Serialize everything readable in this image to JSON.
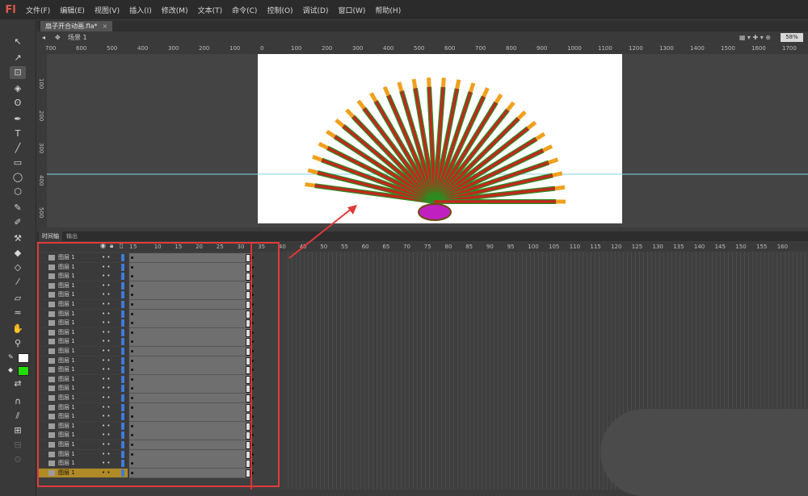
{
  "app": {
    "logo": "Fl"
  },
  "menu": [
    "文件(F)",
    "编辑(E)",
    "视图(V)",
    "插入(I)",
    "修改(M)",
    "文本(T)",
    "命令(C)",
    "控制(O)",
    "调试(D)",
    "窗口(W)",
    "帮助(H)"
  ],
  "document": {
    "tab": "扇子开合动画.fla*",
    "close": "×",
    "scene": "场景 1",
    "zoom": "58%"
  },
  "ruler_h": [
    "700",
    "600",
    "500",
    "400",
    "300",
    "200",
    "100",
    "0",
    "100",
    "200",
    "300",
    "400",
    "500",
    "600",
    "700",
    "800",
    "900",
    "1000",
    "1100",
    "1200",
    "1300",
    "1400",
    "1500",
    "1600",
    "1700"
  ],
  "ruler_v": [
    "100",
    "200",
    "300",
    "400",
    "500"
  ],
  "panels": {
    "timeline": "时间轴",
    "output": "输出"
  },
  "frame_numbers": [
    "1",
    "5",
    "10",
    "15",
    "20",
    "25",
    "30",
    "35",
    "40",
    "45",
    "50",
    "55",
    "60",
    "65",
    "70",
    "75",
    "80",
    "85",
    "90",
    "95",
    "100",
    "105",
    "110",
    "115",
    "120",
    "125",
    "130",
    "135",
    "140",
    "145",
    "150",
    "155",
    "160"
  ],
  "layers": [
    {
      "name": "图层 1"
    },
    {
      "name": "图层 1"
    },
    {
      "name": "图层 1"
    },
    {
      "name": "图层 1"
    },
    {
      "name": "图层 1"
    },
    {
      "name": "图层 1"
    },
    {
      "name": "图层 1"
    },
    {
      "name": "图层 1"
    },
    {
      "name": "图层 1"
    },
    {
      "name": "图层 1"
    },
    {
      "name": "图层 1"
    },
    {
      "name": "图层 1"
    },
    {
      "name": "图层 1"
    },
    {
      "name": "图层 1"
    },
    {
      "name": "图层 1"
    },
    {
      "name": "图层 1"
    },
    {
      "name": "图层 1"
    },
    {
      "name": "图层 1"
    },
    {
      "name": "图层 1"
    },
    {
      "name": "图层 1"
    },
    {
      "name": "图层 1"
    },
    {
      "name": "图层 1"
    },
    {
      "name": "图层 1"
    },
    {
      "name": "图层 1"
    }
  ],
  "layer_dots": "•  •",
  "colors": {
    "accent": "#e23a3a",
    "selected_layer": "#b08a26",
    "fill_swatch": "#22dd00"
  }
}
